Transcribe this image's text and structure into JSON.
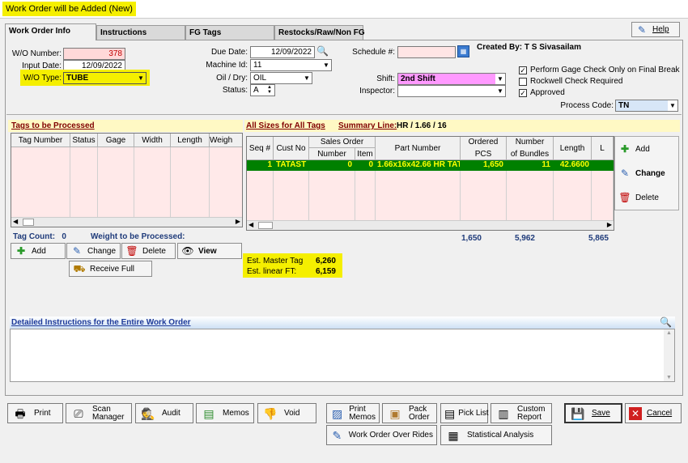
{
  "window": {
    "title": "Work Order will be Added  (New)"
  },
  "tabs": [
    {
      "label": "Work Order Info"
    },
    {
      "label": "Instructions"
    },
    {
      "label": "FG Tags"
    },
    {
      "label": "Restocks/Raw/Non FG"
    }
  ],
  "help": {
    "label": "Help"
  },
  "form": {
    "wo_number_label": "W/O Number:",
    "wo_number": "378",
    "input_date_label": "Input Date:",
    "input_date": "12/09/2022",
    "wo_type_label": "W/O Type:",
    "wo_type": "TUBE",
    "due_date_label": "Due Date:",
    "due_date": "12/09/2022",
    "machine_id_label": "Machine Id:",
    "machine_id": "11",
    "oil_dry_label": "Oil / Dry:",
    "oil_dry": "OIL",
    "status_label": "Status:",
    "status": "A",
    "schedule_label": "Schedule #:",
    "schedule": "",
    "created_by_label": "Created By:",
    "created_by": "T S Sivasailam",
    "shift_label": "Shift:",
    "shift": "2nd Shift",
    "inspector_label": "Inspector:",
    "inspector": "",
    "process_code_label": "Process Code:",
    "process_code": "TN"
  },
  "checks": [
    {
      "label": "Perform Gage Check Only on Final Break",
      "checked": "✓"
    },
    {
      "label": "Rockwell Check Required",
      "checked": ""
    },
    {
      "label": "Approved",
      "checked": "✓"
    }
  ],
  "tags": {
    "title": "Tags to be Processed",
    "columns": [
      "Tag Number",
      "Status",
      "Gage",
      "Width",
      "Length",
      "Weigh"
    ],
    "count_label": "Tag Count:",
    "count": "0",
    "weight_label": "Weight to be Processed:",
    "add": "Add",
    "change": "Change",
    "delete": "Delete",
    "view": "View",
    "receive_full": "Receive Full"
  },
  "sizes": {
    "title": "All Sizes for All Tags",
    "summary_label": "Summary Line:",
    "summary": "HR / 1.66 / 16",
    "columns": {
      "seq": "Seq #",
      "cust": "Cust No",
      "so": "Sales Order",
      "so_num": "Number",
      "so_item": "Item",
      "part": "Part Number",
      "ordered": "Ordered",
      "pcs": "PCS",
      "number": "Number",
      "bundles": "of Bundles",
      "length": "Length",
      "l": "L"
    },
    "row": {
      "seq": "1",
      "cust": "TATAST",
      "so_num": "0",
      "so_item": "0",
      "part": "1.66x16x42.66 HR TAT",
      "pcs": "1,650",
      "bundles": "11",
      "length": "42.6600"
    },
    "totals": {
      "pcs": "1,650",
      "bundles": "5,962",
      "length": "5,865"
    },
    "add": "Add",
    "change": "Change",
    "delete": "Delete"
  },
  "estimates": {
    "master_label": "Est. Master Tag",
    "master": "6,260",
    "linear_label": "Est. linear FT:",
    "linear": "6,159"
  },
  "instructions": {
    "title": "Detailed Instructions for the Entire Work Order",
    "text": ""
  },
  "bottom": {
    "print": "Print",
    "scan1": "Scan",
    "scan2": "Manager",
    "audit": "Audit",
    "memos": "Memos",
    "void": "Void",
    "pmemo1": "Print",
    "pmemo2": "Memos",
    "pack1": "Pack",
    "pack2": "Order",
    "pick": "Pick List",
    "custom1": "Custom",
    "custom2": "Report",
    "save": "Save",
    "cancel": "Cancel",
    "override": "Work Order Over Rides",
    "stats": "Statistical Analysis"
  },
  "colors": {
    "title_bg": "#f5ef00",
    "highlight": "#f5ef00",
    "pink": "#ffd9d9",
    "shift": "#ff99ff",
    "row": "#008000",
    "row_text": "#ffff00"
  }
}
